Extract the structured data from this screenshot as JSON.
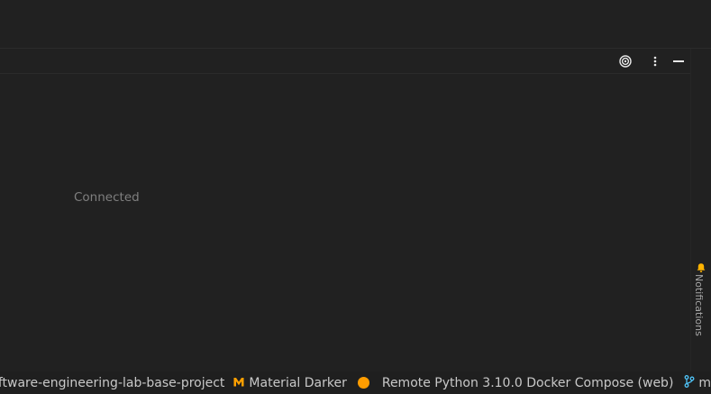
{
  "panel": {
    "status_text": "Connected",
    "icons": {
      "target": "target-icon",
      "more": "more-vertical-icon",
      "minimize": "minimize-icon"
    }
  },
  "notifications": {
    "label": "Notifications",
    "icon": "bell-icon",
    "accent_color": "#ffb300"
  },
  "status_bar": {
    "project": "software-engineering-lab-base-project",
    "theme": "Material Darker",
    "theme_icon": "material-theme-icon",
    "interpreter": "Remote Python 3.10.0 Docker Compose (web)",
    "interpreter_dot_color": "#ff9d00",
    "branch": "main",
    "branch_icon": "git-branch-icon",
    "branch_icon_color": "#4fc3f7"
  }
}
